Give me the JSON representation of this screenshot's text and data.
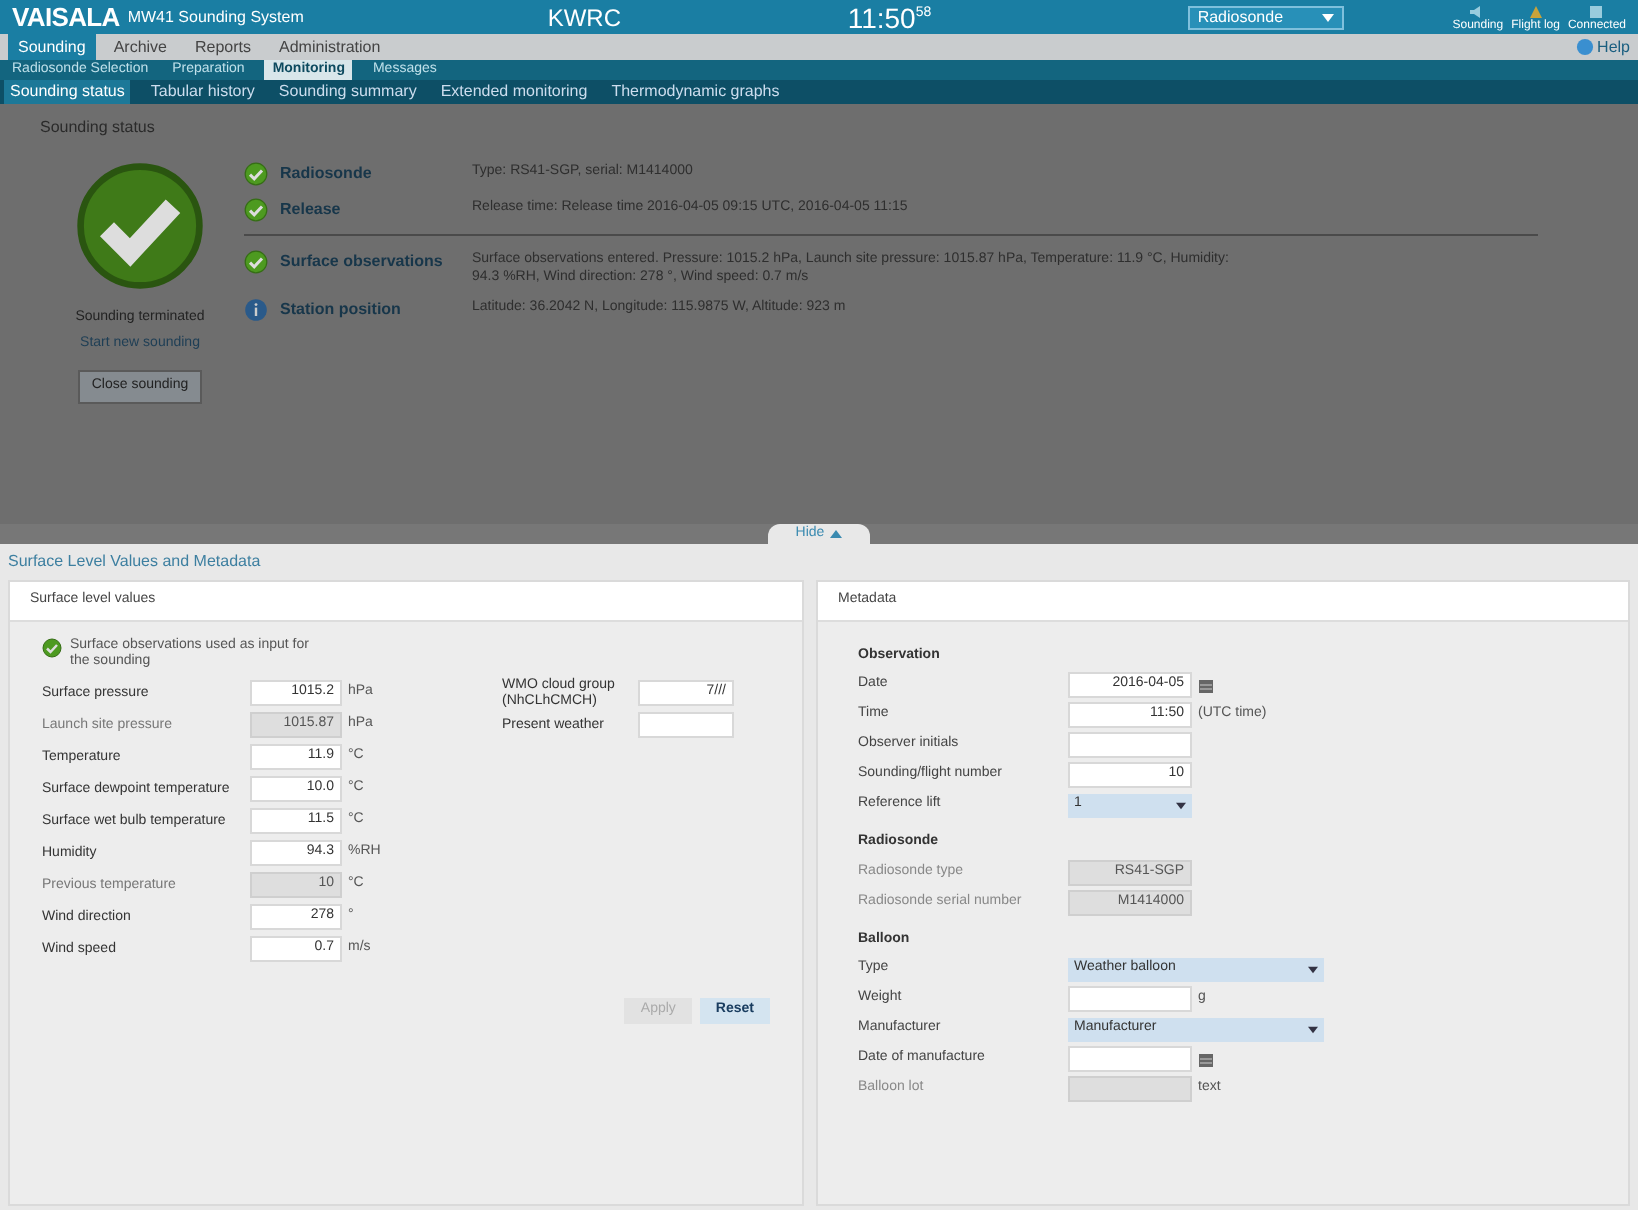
{
  "header": {
    "logo": "VAISALA",
    "product": "MW41 Sounding System",
    "station": "KWRC",
    "time": "11:50",
    "time_seconds": "58",
    "dropdown": "Radiosonde",
    "icons": [
      {
        "label": "Sounding"
      },
      {
        "label": "Flight log"
      },
      {
        "label": "Connected"
      }
    ]
  },
  "main_tabs": [
    {
      "label": "Sounding",
      "selected": true
    },
    {
      "label": "Archive",
      "selected": false
    },
    {
      "label": "Reports",
      "selected": false
    },
    {
      "label": "Administration",
      "selected": false
    }
  ],
  "help": "Help",
  "sub_tabs": [
    {
      "label": "Radiosonde Selection",
      "selected": false
    },
    {
      "label": "Preparation",
      "selected": false
    },
    {
      "label": "Monitoring",
      "selected": true
    },
    {
      "label": "Messages",
      "selected": false
    }
  ],
  "view_tabs": [
    {
      "label": "Sounding status",
      "selected": true
    },
    {
      "label": "Tabular history",
      "selected": false
    },
    {
      "label": "Sounding summary",
      "selected": false
    },
    {
      "label": "Extended monitoring",
      "selected": false
    },
    {
      "label": "Thermodynamic graphs",
      "selected": false
    }
  ],
  "status": {
    "title": "Sounding status",
    "result": "Sounding terminated",
    "link": "Start new sounding",
    "button": "Close sounding",
    "items": [
      {
        "kind": "ok",
        "label": "Radiosonde",
        "text": "Type: RS41-SGP, serial: M1414000",
        "divider": false
      },
      {
        "kind": "ok",
        "label": "Release",
        "text": "Release time: Release time 2016-04-05 09:15 UTC, 2016-04-05 11:15",
        "divider": true
      },
      {
        "kind": "ok",
        "label": "Surface observations",
        "text": "Surface observations entered. Pressure: 1015.2 hPa, Launch site pressure: 1015.87 hPa, Temperature: 11.9 °C, Humidity: 94.3 %RH, Wind direction: 278 °, Wind speed: 0.7 m/s",
        "divider": false
      },
      {
        "kind": "info",
        "label": "Station position",
        "text": "Latitude: 36.2042 N, Longitude: 115.9875 W, Altitude: 923 m",
        "divider": false
      }
    ]
  },
  "hide_tab": "Hide",
  "panel_title": "Surface Level Values and Metadata",
  "surface": {
    "title": "Surface level values",
    "note": "Surface observations used as input for the sounding",
    "fields": [
      {
        "label": "Surface pressure",
        "value": "1015.2",
        "unit": "hPa",
        "disabled": false
      },
      {
        "label": "Launch site pressure",
        "value": "1015.87",
        "unit": "hPa",
        "disabled": true
      },
      {
        "label": "Temperature",
        "value": "11.9",
        "unit": "°C",
        "disabled": false
      },
      {
        "label": "Surface dewpoint temperature",
        "value": "10.0",
        "unit": "°C",
        "disabled": false
      },
      {
        "label": "Surface wet bulb temperature",
        "value": "11.5",
        "unit": "°C",
        "disabled": false
      },
      {
        "label": "Humidity",
        "value": "94.3",
        "unit": "%RH",
        "disabled": false
      },
      {
        "label": "Previous temperature",
        "value": "10",
        "unit": "°C",
        "disabled": true
      },
      {
        "label": "Wind direction",
        "value": "278",
        "unit": "°",
        "disabled": false
      },
      {
        "label": "Wind speed",
        "value": "0.7",
        "unit": "m/s",
        "disabled": false
      }
    ],
    "right_fields": [
      {
        "label": "WMO cloud group (NhCLhCMCH)",
        "value": "7///"
      },
      {
        "label": "Present weather"
      }
    ],
    "buttons": [
      {
        "label": "Apply",
        "disabled": true
      },
      {
        "label": "Reset",
        "disabled": false
      }
    ]
  },
  "metadata": {
    "title": "Metadata",
    "sections": [
      {
        "title": "Observation",
        "fields": [
          {
            "kind": "date",
            "label": "Date",
            "value": "2016-04-05",
            "disabled": false
          },
          {
            "kind": "text",
            "label": "Time",
            "value": "11:50",
            "unit": "(UTC time)",
            "disabled": false
          },
          {
            "kind": "text",
            "label": "Observer initials",
            "disabled": false
          },
          {
            "kind": "text",
            "label": "Sounding/flight number",
            "value": "10",
            "disabled": false
          },
          {
            "kind": "select",
            "label": "Reference lift",
            "value": "1"
          }
        ]
      },
      {
        "title": "Radiosonde",
        "fields": [
          {
            "kind": "text",
            "label": "Radiosonde type",
            "value": "RS41-SGP",
            "disabled": true
          },
          {
            "kind": "text",
            "label": "Radiosonde serial number",
            "value": "M1414000",
            "disabled": true
          }
        ]
      },
      {
        "title": "Balloon",
        "fields": [
          {
            "kind": "wide_select",
            "label": "Type",
            "value": "Weather balloon"
          },
          {
            "kind": "text",
            "label": "Weight",
            "unit": "g",
            "disabled": false
          },
          {
            "kind": "wide_select",
            "label": "Manufacturer",
            "value": "Manufacturer"
          },
          {
            "kind": "date",
            "label": "Date of manufacture",
            "disabled": false
          },
          {
            "kind": "text",
            "label": "Balloon lot",
            "unit": "text",
            "disabled": true
          }
        ]
      }
    ]
  }
}
